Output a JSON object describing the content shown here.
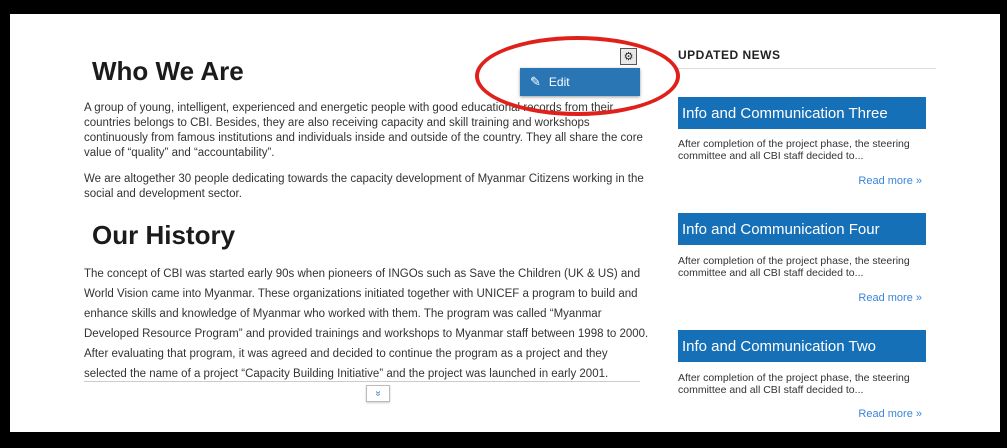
{
  "about": {
    "heading": "Who We Are",
    "paragraphs": [
      "A group of young, intelligent, experienced and energetic people with good educational records from their countries belongs to CBI. Besides, they are also receiving capacity and skill training and workshops continuously from famous institutions and individuals inside and outside of the country. They all share the core value of “quality” and “accountability”.",
      "We are altogether 30 people dedicating towards the capacity development of Myanmar Citizens working in the social and development sector."
    ]
  },
  "history": {
    "heading": "Our History",
    "paragraph": "The concept of CBI was started early 90s when pioneers of INGOs such as Save the Children (UK & US) and World Vision came into Myanmar. These organizations initiated together with UNICEF a program to build and enhance skills and knowledge of Myanmar who worked with them. The program was called “Myanmar Developed Resource Program” and provided trainings and workshops to Myanmar staff between 1998 to 2000. After evaluating that program, it was agreed and decided to continue the program as a project and they selected the name of a project “Capacity Building Initiative” and the project was launched in early 2001."
  },
  "edit_menu": {
    "gear_icon": "gear-icon",
    "edit_label": "Edit",
    "edit_icon": "edit-icon"
  },
  "expand": {
    "icon": "double-chevron-down-icon",
    "glyph": "»"
  },
  "news": {
    "heading": "UPDATED NEWS",
    "items": [
      {
        "title": "Info and Communication Three",
        "excerpt": "After completion of the project phase, the steering committee and all CBI staff decided to...",
        "read_more": "Read more »"
      },
      {
        "title": "Info and Communication Four",
        "excerpt": "After completion of the project phase, the steering committee and all CBI staff decided to...",
        "read_more": "Read more »"
      },
      {
        "title": "Info and Communication Two",
        "excerpt": "After completion of the project phase, the steering committee and all CBI staff decided to...",
        "read_more": "Read more »"
      }
    ]
  },
  "colors": {
    "accent": "#1670b8",
    "annotation": "#e0201a",
    "link": "#3a86d6"
  }
}
